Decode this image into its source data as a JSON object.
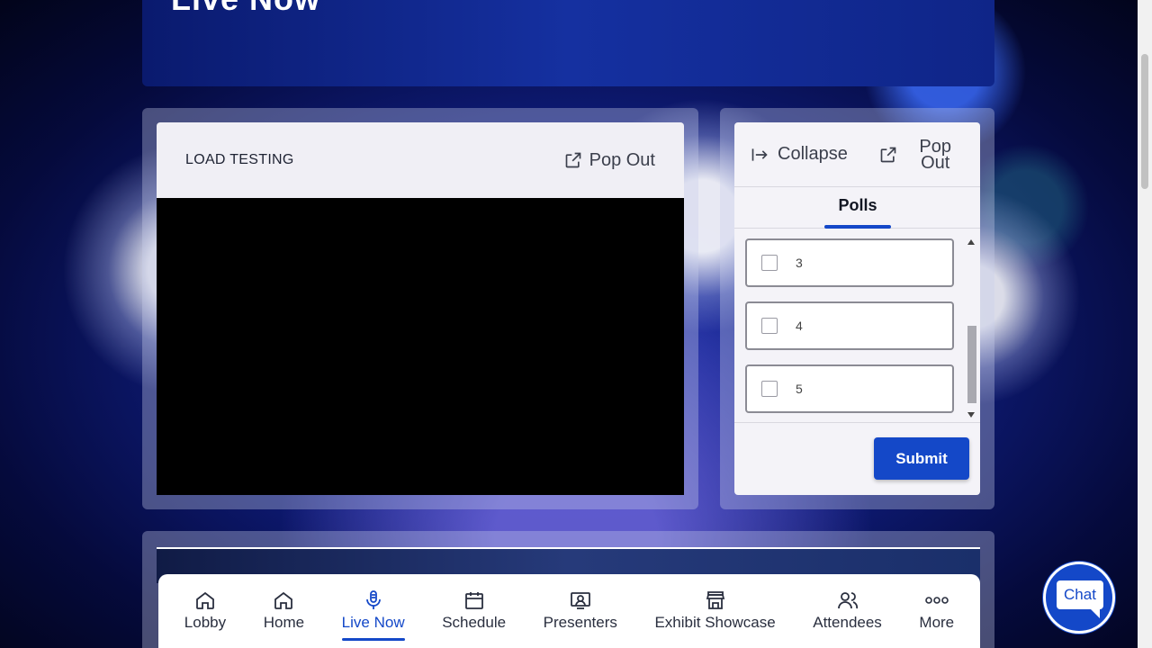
{
  "hero": {
    "title": "Live Now"
  },
  "video": {
    "title": "LOAD TESTING",
    "popout_label": "Pop Out"
  },
  "side_panel": {
    "collapse_label": "Collapse",
    "popout_line1": "Pop",
    "popout_line2": "Out",
    "tab_label": "Polls",
    "options": [
      {
        "label": "3"
      },
      {
        "label": "4"
      },
      {
        "label": "5"
      }
    ],
    "submit_label": "Submit"
  },
  "nav": {
    "items": [
      {
        "label": "Lobby",
        "icon": "house-icon"
      },
      {
        "label": "Home",
        "icon": "house-icon"
      },
      {
        "label": "Live Now",
        "icon": "microphone-icon",
        "active": true
      },
      {
        "label": "Schedule",
        "icon": "calendar-icon"
      },
      {
        "label": "Presenters",
        "icon": "presenter-icon"
      },
      {
        "label": "Exhibit Showcase",
        "icon": "store-icon"
      },
      {
        "label": "Attendees",
        "icon": "users-icon"
      },
      {
        "label": "More",
        "icon": "more-icon"
      }
    ]
  },
  "chat": {
    "label": "Chat"
  },
  "colors": {
    "accent": "#1448c8",
    "panel": "#f0eff5"
  }
}
